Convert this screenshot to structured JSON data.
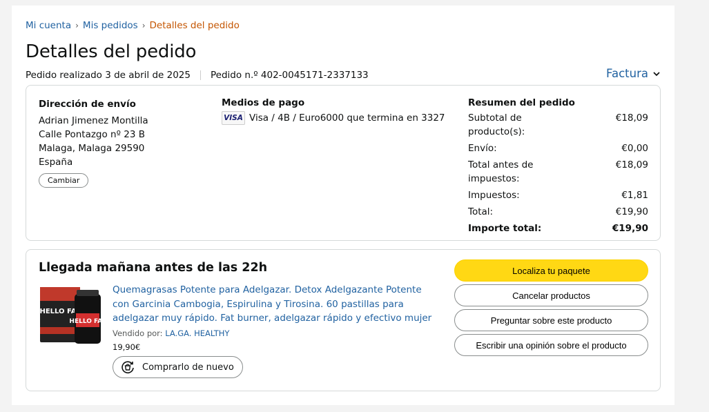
{
  "breadcrumb": {
    "items": [
      "Mi cuenta",
      "Mis pedidos",
      "Detalles del pedido"
    ],
    "separator": "›"
  },
  "page_title": "Detalles del pedido",
  "order_meta": {
    "placed": "Pedido realizado 3 de abril de 2025",
    "number": "Pedido n.º 402-0045171-2337133"
  },
  "invoice_label": "Factura",
  "shipping": {
    "heading": "Dirección de envío",
    "lines": [
      "Adrian Jimenez Montilla",
      "Calle Pontazgo nº 23 B",
      "Malaga, Malaga 29590",
      "España"
    ],
    "change_label": "Cambiar"
  },
  "payment": {
    "heading": "Medios de pago",
    "card_brand": "VISA",
    "description": "Visa / 4B / Euro6000 que termina en 3327"
  },
  "summary": {
    "heading": "Resumen del pedido",
    "rows": [
      {
        "label": "Subtotal de producto(s):",
        "value": "€18,09"
      },
      {
        "label": "Envío:",
        "value": "€0,00"
      },
      {
        "label": "Total antes de impuestos:",
        "value": "€18,09"
      },
      {
        "label": "Impuestos:",
        "value": "€1,81"
      },
      {
        "label": "Total:",
        "value": "€19,90"
      }
    ],
    "grand_total": {
      "label": "Importe total:",
      "value": "€19,90"
    }
  },
  "shipment": {
    "arrival": "Llegada mañana antes de las 22h",
    "product_title": "Quemagrasas Potente para Adelgazar. Detox Adelgazante Potente con Garcinia Cambogia, Espirulina y Tirosina. 60 pastillas para adelgazar muy rápido. Fat burner, adelgazar rápido y efectivo mujer",
    "sold_by_label": "Vendido por:",
    "seller": "LA.GA. HEALTHY",
    "price": "19,90€",
    "buy_again": "Comprarlo de nuevo",
    "product_image_text": "HELLO FAT"
  },
  "actions": {
    "track": "Localiza tu paquete",
    "cancel": "Cancelar productos",
    "ask": "Preguntar sobre este producto",
    "review": "Escribir una opinión sobre el producto"
  },
  "colors": {
    "link": "#2162a1",
    "current_crumb": "#c45500",
    "primary_button": "#ffd814"
  }
}
